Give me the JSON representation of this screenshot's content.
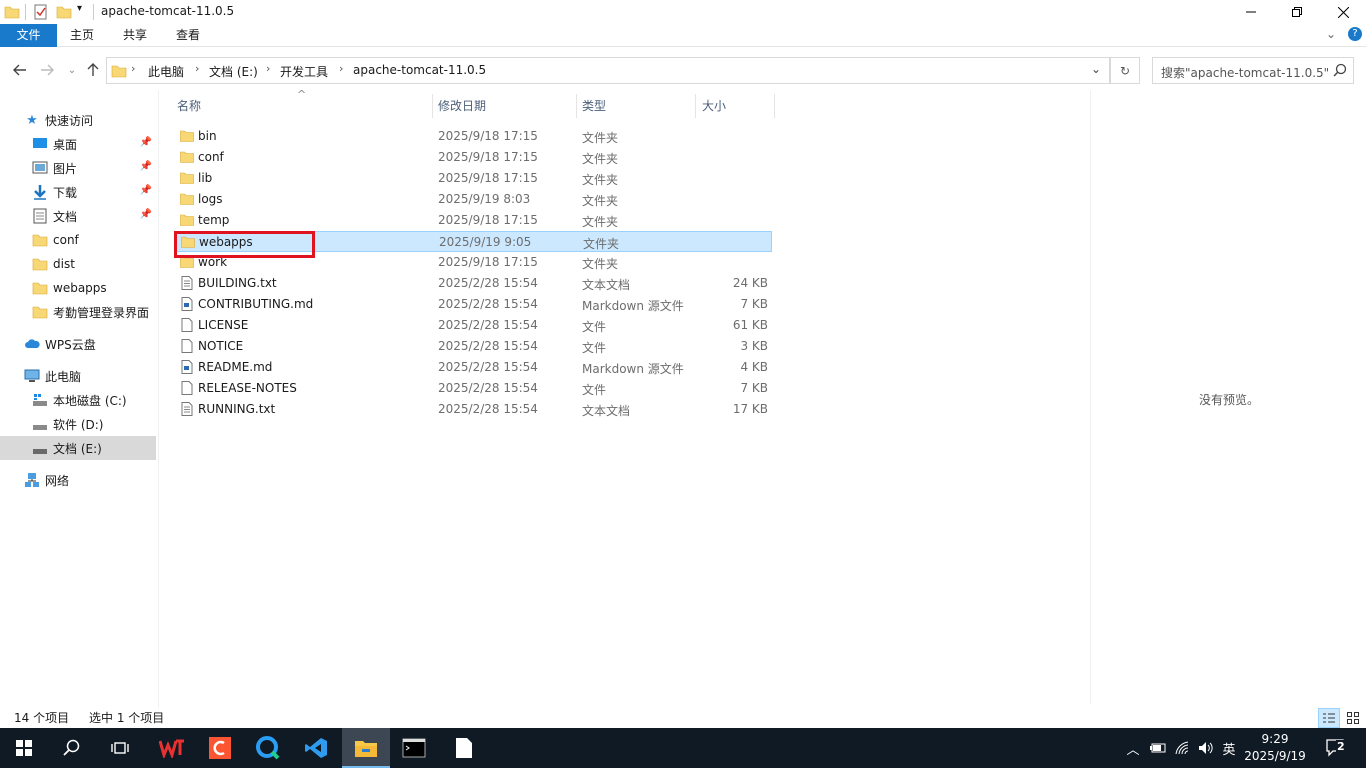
{
  "window": {
    "title": "apache-tomcat-11.0.5",
    "ribbon_tabs": [
      "文件",
      "主页",
      "共享",
      "查看"
    ]
  },
  "address": {
    "crumbs": [
      "此电脑",
      "文档 (E:)",
      "开发工具",
      "apache-tomcat-11.0.5"
    ],
    "search_placeholder": "搜索\"apache-tomcat-11.0.5\""
  },
  "sidebar": {
    "items": [
      {
        "label": "快速访问",
        "icon": "star-icon"
      },
      {
        "label": "桌面",
        "icon": "desktop-icon",
        "pinned": true
      },
      {
        "label": "图片",
        "icon": "pictures-icon",
        "pinned": true
      },
      {
        "label": "下载",
        "icon": "download-icon",
        "pinned": true
      },
      {
        "label": "文档",
        "icon": "documents-icon",
        "pinned": true
      },
      {
        "label": "conf",
        "icon": "folder-icon"
      },
      {
        "label": "dist",
        "icon": "folder-icon"
      },
      {
        "label": "webapps",
        "icon": "folder-icon"
      },
      {
        "label": "考勤管理登录界面",
        "icon": "folder-icon"
      },
      {
        "label": "WPS云盘",
        "icon": "cloud-icon"
      },
      {
        "label": "此电脑",
        "icon": "computer-icon"
      },
      {
        "label": "本地磁盘 (C:)",
        "icon": "drive-icon"
      },
      {
        "label": "软件 (D:)",
        "icon": "drive-icon"
      },
      {
        "label": "文档 (E:)",
        "icon": "drive-icon",
        "selected": true
      },
      {
        "label": "网络",
        "icon": "network-icon"
      }
    ]
  },
  "list": {
    "columns": [
      "名称",
      "修改日期",
      "类型",
      "大小"
    ],
    "rows": [
      {
        "name": "bin",
        "date": "2025/9/18 17:15",
        "type": "文件夹",
        "size": "",
        "kind": "folder"
      },
      {
        "name": "conf",
        "date": "2025/9/18 17:15",
        "type": "文件夹",
        "size": "",
        "kind": "folder"
      },
      {
        "name": "lib",
        "date": "2025/9/18 17:15",
        "type": "文件夹",
        "size": "",
        "kind": "folder"
      },
      {
        "name": "logs",
        "date": "2025/9/19 8:03",
        "type": "文件夹",
        "size": "",
        "kind": "folder"
      },
      {
        "name": "temp",
        "date": "2025/9/18 17:15",
        "type": "文件夹",
        "size": "",
        "kind": "folder"
      },
      {
        "name": "webapps",
        "date": "2025/9/19 9:05",
        "type": "文件夹",
        "size": "",
        "kind": "folder",
        "selected": true
      },
      {
        "name": "work",
        "date": "2025/9/18 17:15",
        "type": "文件夹",
        "size": "",
        "kind": "folder"
      },
      {
        "name": "BUILDING.txt",
        "date": "2025/2/28 15:54",
        "type": "文本文档",
        "size": "24 KB",
        "kind": "text"
      },
      {
        "name": "CONTRIBUTING.md",
        "date": "2025/2/28 15:54",
        "type": "Markdown 源文件",
        "size": "7 KB",
        "kind": "md"
      },
      {
        "name": "LICENSE",
        "date": "2025/2/28 15:54",
        "type": "文件",
        "size": "61 KB",
        "kind": "file"
      },
      {
        "name": "NOTICE",
        "date": "2025/2/28 15:54",
        "type": "文件",
        "size": "3 KB",
        "kind": "file"
      },
      {
        "name": "README.md",
        "date": "2025/2/28 15:54",
        "type": "Markdown 源文件",
        "size": "4 KB",
        "kind": "md"
      },
      {
        "name": "RELEASE-NOTES",
        "date": "2025/2/28 15:54",
        "type": "文件",
        "size": "7 KB",
        "kind": "file"
      },
      {
        "name": "RUNNING.txt",
        "date": "2025/2/28 15:54",
        "type": "文本文档",
        "size": "17 KB",
        "kind": "text"
      }
    ]
  },
  "preview": {
    "text": "没有预览。"
  },
  "status": {
    "count": "14 个项目",
    "selection": "选中 1 个项目"
  },
  "taskbar": {
    "apps": [
      "start-icon",
      "search-icon",
      "task-view-icon",
      "wps-icon",
      "csdn-icon",
      "browser-icon",
      "vscode-icon",
      "file-explorer-icon",
      "terminal-icon",
      "notepad-icon"
    ],
    "time": "9:29",
    "date": "2025/9/19",
    "ime": "英",
    "notifications": "2"
  },
  "colors": {
    "accent": "#1979ca",
    "selection": "#cce8ff",
    "highlight_box": "#e0141e",
    "taskbar": "#101a24",
    "folder": "#f8d775"
  }
}
